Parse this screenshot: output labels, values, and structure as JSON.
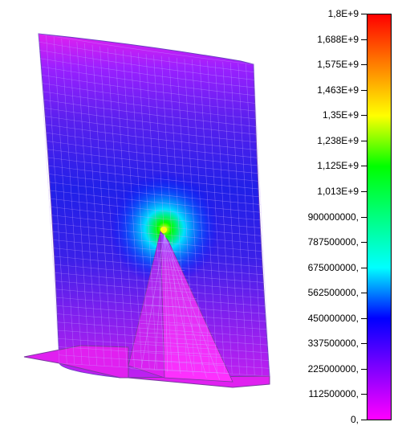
{
  "legend": {
    "labels": [
      "1,8E+9",
      "1,688E+9",
      "1,575E+9",
      "1,463E+9",
      "1,35E+9",
      "1,238E+9",
      "1,125E+9",
      "1,013E+9",
      "900000000,",
      "787500000,",
      "675000000,",
      "562500000,",
      "450000000,",
      "337500000,",
      "225000000,",
      "112500000,",
      "0,"
    ],
    "colors": {
      "top": "#ff0000",
      "orange": "#ff8000",
      "yellow": "#ffff00",
      "green": "#00ff00",
      "cyan": "#00ffff",
      "blue": "#0000ff",
      "purple": "#8000ff",
      "magenta": "#ff00ff"
    }
  }
}
